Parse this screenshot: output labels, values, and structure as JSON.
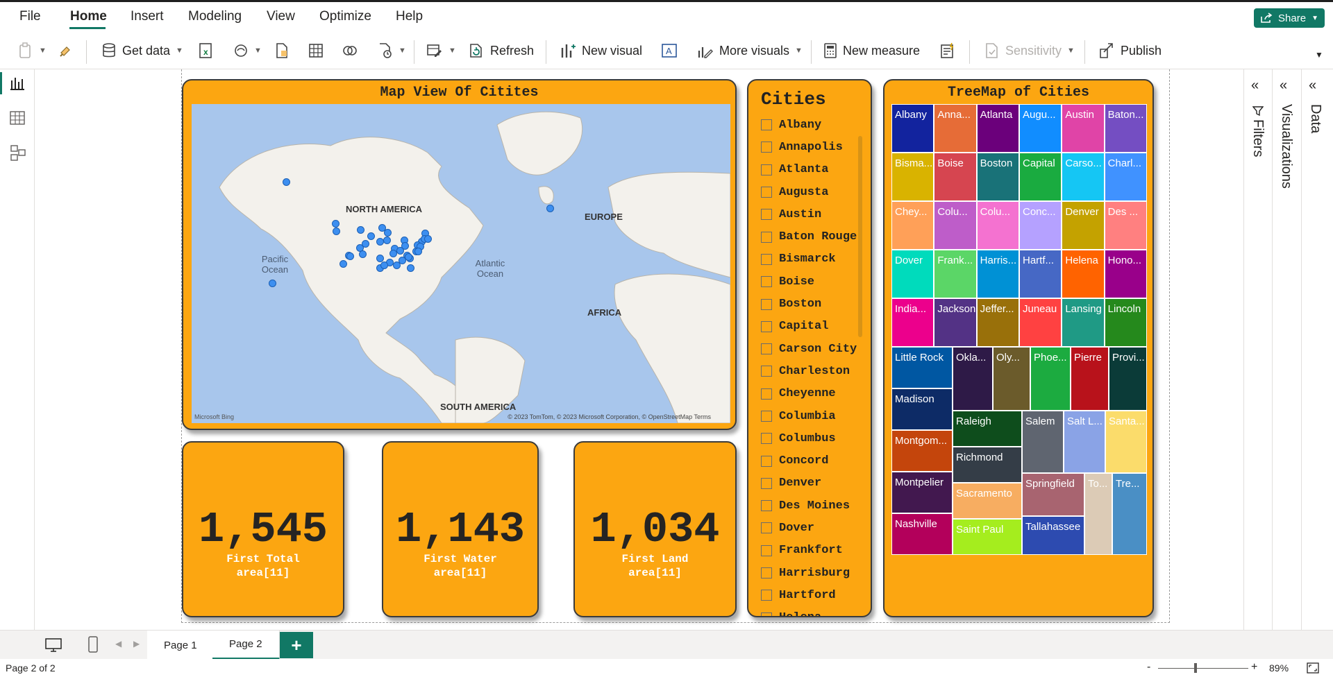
{
  "menu": {
    "file": "File",
    "home": "Home",
    "insert": "Insert",
    "modeling": "Modeling",
    "view": "View",
    "optimize": "Optimize",
    "help": "Help",
    "share": "Share"
  },
  "toolbar": {
    "get_data": "Get data",
    "refresh": "Refresh",
    "new_visual": "New visual",
    "more_visuals": "More visuals",
    "new_measure": "New measure",
    "sensitivity": "Sensitivity",
    "publish": "Publish"
  },
  "map_card": {
    "title": "Map View Of Citites",
    "labels": {
      "na": "NORTH AMERICA",
      "eu": "EUROPE",
      "af": "AFRICA",
      "sa": "SOUTH AMERICA",
      "pacific": "Pacific Ocean",
      "atlantic": "Atlantic Ocean"
    },
    "attribution": "© 2023 TomTom, © 2023 Microsoft Corporation, © OpenStreetMap  Terms",
    "logo": "Microsoft Bing"
  },
  "kpis": [
    {
      "value": "1,545",
      "label": "First Total area[11]"
    },
    {
      "value": "1,143",
      "label": "First Water area[11]"
    },
    {
      "value": "1,034",
      "label": "First Land area[11]"
    }
  ],
  "slicer": {
    "title": "Cities",
    "items": [
      "Albany",
      "Annapolis",
      "Atlanta",
      "Augusta",
      "Austin",
      "Baton Rouge",
      "Bismarck",
      "Boise",
      "Boston",
      "Capital",
      "Carson City",
      "Charleston",
      "Cheyenne",
      "Columbia",
      "Columbus",
      "Concord",
      "Denver",
      "Des Moines",
      "Dover",
      "Frankfort",
      "Harrisburg",
      "Hartford",
      "Helena"
    ]
  },
  "treemap": {
    "title": "TreeMap of Cities",
    "cells": [
      {
        "label": "Albany",
        "color": "#12239e"
      },
      {
        "label": "Anna...",
        "color": "#e66c37"
      },
      {
        "label": "Atlanta",
        "color": "#6b007b"
      },
      {
        "label": "Augu...",
        "color": "#118dff"
      },
      {
        "label": "Austin",
        "color": "#e044a7"
      },
      {
        "label": "Baton...",
        "color": "#744ec2"
      },
      {
        "label": "Bisma...",
        "color": "#d9b300"
      },
      {
        "label": "Boise",
        "color": "#d64550"
      },
      {
        "label": "Boston",
        "color": "#197278"
      },
      {
        "label": "Capital",
        "color": "#1aab40"
      },
      {
        "label": "Carso...",
        "color": "#15c6f4"
      },
      {
        "label": "Charl...",
        "color": "#4092ff"
      },
      {
        "label": "Chey...",
        "color": "#ffa058"
      },
      {
        "label": "Colu...",
        "color": "#be5dc9"
      },
      {
        "label": "Colu...",
        "color": "#f472d0"
      },
      {
        "label": "Conc...",
        "color": "#b5a1ff"
      },
      {
        "label": "Denver",
        "color": "#c4a200"
      },
      {
        "label": "Des ...",
        "color": "#ff8080"
      },
      {
        "label": "Dover",
        "color": "#00dbbc"
      },
      {
        "label": "Frank...",
        "color": "#5bd667"
      },
      {
        "label": "Harris...",
        "color": "#0091d5"
      },
      {
        "label": "Hartf...",
        "color": "#4668c5"
      },
      {
        "label": "Helena",
        "color": "#ff6300"
      },
      {
        "label": "Hono...",
        "color": "#99008a"
      },
      {
        "label": "India...",
        "color": "#ec008c"
      },
      {
        "label": "Jackson",
        "color": "#533285"
      },
      {
        "label": "Jeffer...",
        "color": "#99700a"
      },
      {
        "label": "Juneau",
        "color": "#ff4141"
      },
      {
        "label": "Lansing",
        "color": "#1f9a85"
      },
      {
        "label": "Lincoln",
        "color": "#25891c"
      },
      {
        "label": "Little Rock",
        "color": "#0057a2"
      },
      {
        "label": "Okla...",
        "color": "#2e1a47"
      },
      {
        "label": "Oly...",
        "color": "#6b5b2b"
      },
      {
        "label": "Phoe...",
        "color": "#1cab40"
      },
      {
        "label": "Pierre",
        "color": "#b8121b"
      },
      {
        "label": "Provi...",
        "color": "#0b3b38"
      },
      {
        "label": "Madison",
        "color": "#0d2b66"
      },
      {
        "label": "Raleigh",
        "color": "#0e4d1c"
      },
      {
        "label": "Salem",
        "color": "#5f6570"
      },
      {
        "label": "Salt L...",
        "color": "#8aa3e6"
      },
      {
        "label": "Santa...",
        "color": "#fbdc6b"
      },
      {
        "label": "Montgom...",
        "color": "#c4450c"
      },
      {
        "label": "Richmond",
        "color": "#343d47"
      },
      {
        "label": "Montpelier",
        "color": "#42184f"
      },
      {
        "label": "Sacramento",
        "color": "#f7ad61"
      },
      {
        "label": "Springfield",
        "color": "#a86470"
      },
      {
        "label": "To...",
        "color": "#dccbb6"
      },
      {
        "label": "Tre...",
        "color": "#4a8fc5"
      },
      {
        "label": "Nashville",
        "color": "#b3005b"
      },
      {
        "label": "Saint Paul",
        "color": "#a5ed1e"
      },
      {
        "label": "Tallahassee",
        "color": "#2d4bb0"
      }
    ]
  },
  "panes": {
    "filters": "Filters",
    "visualizations": "Visualizations",
    "data": "Data"
  },
  "pages": {
    "page1": "Page 1",
    "page2": "Page 2",
    "add": "+"
  },
  "status": {
    "page_info": "Page 2 of 2",
    "zoom": "89%",
    "minus": "-",
    "plus": "+"
  }
}
